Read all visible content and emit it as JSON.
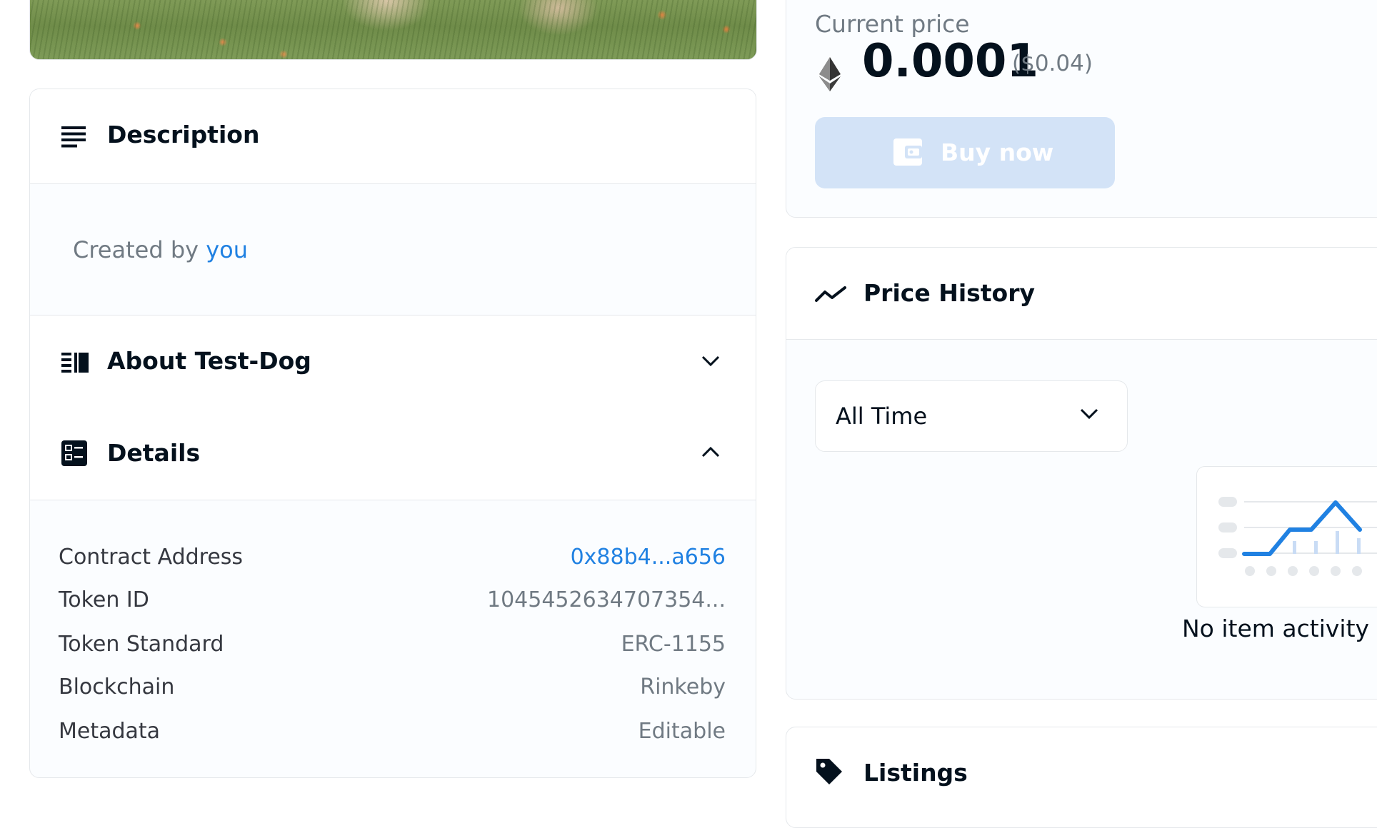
{
  "description": {
    "title": "Description",
    "created_by_prefix": "Created by",
    "created_by_user": "you"
  },
  "about": {
    "title": "About Test-Dog"
  },
  "details": {
    "title": "Details",
    "rows": [
      {
        "label": "Contract Address",
        "value": "0x88b4...a656"
      },
      {
        "label": "Token ID",
        "value": "1045452634707354..."
      },
      {
        "label": "Token Standard",
        "value": "ERC-1155"
      },
      {
        "label": "Blockchain",
        "value": "Rinkeby"
      },
      {
        "label": "Metadata",
        "value": "Editable"
      }
    ]
  },
  "price": {
    "label": "Current price",
    "value": "0.0001",
    "usd": "($0.04)",
    "buy_label": "Buy now"
  },
  "price_history": {
    "title": "Price History",
    "range": "All Time",
    "empty_text": "No item activity y"
  },
  "listings": {
    "title": "Listings"
  },
  "colors": {
    "link": "#2081e2",
    "text": "#04111d",
    "muted": "#707a83",
    "buy_button_disabled": "#d3e3f7"
  }
}
